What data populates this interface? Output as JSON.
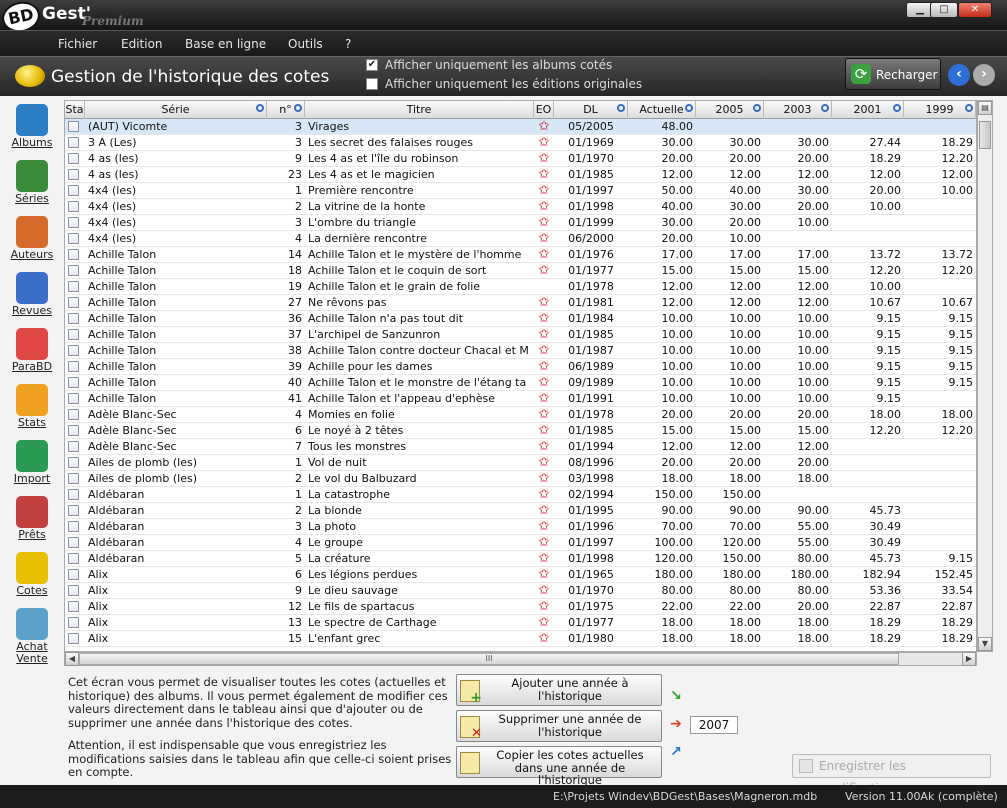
{
  "app": {
    "logo_bd": "BD",
    "logo_gest": "Gest'",
    "logo_premium": "Premium"
  },
  "menu": [
    "Fichier",
    "Edition",
    "Base en ligne",
    "Outils",
    "?"
  ],
  "header": {
    "title": "Gestion de l'historique des cotes",
    "chk1": "Afficher uniquement les albums cotés",
    "chk2": "Afficher uniquement les éditions originales",
    "reload": "Recharger"
  },
  "sidebar": [
    {
      "label": "Albums",
      "color": "#2d7fc4"
    },
    {
      "label": "Séries",
      "color": "#3c8a3c"
    },
    {
      "label": "Auteurs",
      "color": "#d66a2a"
    },
    {
      "label": "Revues",
      "color": "#3a6fc8"
    },
    {
      "label": "ParaBD",
      "color": "#e04848"
    },
    {
      "label": "Stats",
      "color": "#f0a020"
    },
    {
      "label": "Import",
      "color": "#2a9a55"
    },
    {
      "label": "Prêts",
      "color": "#c04040"
    },
    {
      "label": "Cotes",
      "color": "#e8c000"
    },
    {
      "label": "Achat Vente",
      "color": "#5aa0c8"
    }
  ],
  "columns": [
    "Sta",
    "Série",
    "n°",
    "Titre",
    "EO",
    "DL",
    "Actuelle",
    "2005",
    "2003",
    "2001",
    "1999"
  ],
  "rows": [
    [
      "(AUT) Vicomte",
      "3",
      "Virages",
      1,
      "05/2005",
      "48.00",
      "",
      "",
      "",
      ""
    ],
    [
      "3 A (Les)",
      "3",
      "Les secret des falaises rouges",
      1,
      "01/1969",
      "30.00",
      "30.00",
      "30.00",
      "27.44",
      "18.29"
    ],
    [
      "4 as (les)",
      "9",
      "Les 4 as et l'île du robinson",
      1,
      "01/1970",
      "20.00",
      "20.00",
      "20.00",
      "18.29",
      "12.20"
    ],
    [
      "4 as (les)",
      "23",
      "Les 4 as et le magicien",
      1,
      "01/1985",
      "12.00",
      "12.00",
      "12.00",
      "12.00",
      "12.00"
    ],
    [
      "4x4 (les)",
      "1",
      "Première rencontre",
      1,
      "01/1997",
      "50.00",
      "40.00",
      "30.00",
      "20.00",
      "10.00"
    ],
    [
      "4x4 (les)",
      "2",
      "La vitrine de la honte",
      1,
      "01/1998",
      "40.00",
      "30.00",
      "20.00",
      "10.00",
      ""
    ],
    [
      "4x4 (les)",
      "3",
      "L'ombre du triangle",
      1,
      "01/1999",
      "30.00",
      "20.00",
      "10.00",
      "",
      ""
    ],
    [
      "4x4 (les)",
      "4",
      "La dernière rencontre",
      1,
      "06/2000",
      "20.00",
      "10.00",
      "",
      "",
      ""
    ],
    [
      "Achille Talon",
      "14",
      "Achille Talon et le mystère de l'homme",
      1,
      "01/1976",
      "17.00",
      "17.00",
      "17.00",
      "13.72",
      "13.72"
    ],
    [
      "Achille Talon",
      "18",
      "Achille Talon et le coquin de sort",
      1,
      "01/1977",
      "15.00",
      "15.00",
      "15.00",
      "12.20",
      "12.20"
    ],
    [
      "Achille Talon",
      "19",
      "Achille Talon et le grain de folie",
      0,
      "01/1978",
      "12.00",
      "12.00",
      "12.00",
      "10.00",
      ""
    ],
    [
      "Achille Talon",
      "27",
      "Ne rêvons pas",
      1,
      "01/1981",
      "12.00",
      "12.00",
      "12.00",
      "10.67",
      "10.67"
    ],
    [
      "Achille Talon",
      "36",
      "Achille Talon n'a pas tout dit",
      1,
      "01/1984",
      "10.00",
      "10.00",
      "10.00",
      "9.15",
      "9.15"
    ],
    [
      "Achille Talon",
      "37",
      "L'archipel de Sanzunron",
      1,
      "01/1985",
      "10.00",
      "10.00",
      "10.00",
      "9.15",
      "9.15"
    ],
    [
      "Achille Talon",
      "38",
      "Achille Talon contre docteur Chacal et M",
      1,
      "01/1987",
      "10.00",
      "10.00",
      "10.00",
      "9.15",
      "9.15"
    ],
    [
      "Achille Talon",
      "39",
      "Achille pour les dames",
      1,
      "06/1989",
      "10.00",
      "10.00",
      "10.00",
      "9.15",
      "9.15"
    ],
    [
      "Achille Talon",
      "40",
      "Achille Talon et le monstre de l'étang ta",
      1,
      "09/1989",
      "10.00",
      "10.00",
      "10.00",
      "9.15",
      "9.15"
    ],
    [
      "Achille Talon",
      "41",
      "Achille Talon et l'appeau d'ephèse",
      1,
      "01/1991",
      "10.00",
      "10.00",
      "10.00",
      "9.15",
      ""
    ],
    [
      "Adèle Blanc-Sec",
      "4",
      "Momies en folie",
      1,
      "01/1978",
      "20.00",
      "20.00",
      "20.00",
      "18.00",
      "18.00"
    ],
    [
      "Adèle Blanc-Sec",
      "6",
      "Le noyé à 2 têtes",
      1,
      "01/1985",
      "15.00",
      "15.00",
      "15.00",
      "12.20",
      "12.20"
    ],
    [
      "Adèle Blanc-Sec",
      "7",
      "Tous les monstres",
      1,
      "01/1994",
      "12.00",
      "12.00",
      "12.00",
      "",
      ""
    ],
    [
      "Ailes de plomb (les)",
      "1",
      "Vol de nuit",
      1,
      "08/1996",
      "20.00",
      "20.00",
      "20.00",
      "",
      ""
    ],
    [
      "Ailes de plomb (les)",
      "2",
      "Le vol du Balbuzard",
      1,
      "03/1998",
      "18.00",
      "18.00",
      "18.00",
      "",
      ""
    ],
    [
      "Aldébaran",
      "1",
      "La catastrophe",
      1,
      "02/1994",
      "150.00",
      "150.00",
      "",
      "",
      ""
    ],
    [
      "Aldébaran",
      "2",
      "La blonde",
      1,
      "01/1995",
      "90.00",
      "90.00",
      "90.00",
      "45.73",
      ""
    ],
    [
      "Aldébaran",
      "3",
      "La photo",
      1,
      "01/1996",
      "70.00",
      "70.00",
      "55.00",
      "30.49",
      ""
    ],
    [
      "Aldébaran",
      "4",
      "Le groupe",
      1,
      "01/1997",
      "100.00",
      "120.00",
      "55.00",
      "30.49",
      ""
    ],
    [
      "Aldébaran",
      "5",
      "La créature",
      1,
      "01/1998",
      "120.00",
      "150.00",
      "80.00",
      "45.73",
      "9.15"
    ],
    [
      "Alix",
      "6",
      "Les légions perdues",
      1,
      "01/1965",
      "180.00",
      "180.00",
      "180.00",
      "182.94",
      "152.45"
    ],
    [
      "Alix",
      "9",
      "Le dieu sauvage",
      1,
      "01/1970",
      "80.00",
      "80.00",
      "80.00",
      "53.36",
      "33.54"
    ],
    [
      "Alix",
      "12",
      "Le fils de spartacus",
      1,
      "01/1975",
      "22.00",
      "22.00",
      "20.00",
      "22.87",
      "22.87"
    ],
    [
      "Alix",
      "13",
      "Le spectre de Carthage",
      1,
      "01/1977",
      "18.00",
      "18.00",
      "18.00",
      "18.29",
      "18.29"
    ],
    [
      "Alix",
      "15",
      "L'enfant grec",
      1,
      "01/1980",
      "18.00",
      "18.00",
      "18.00",
      "18.29",
      "18.29"
    ]
  ],
  "footer": {
    "desc1": "Cet écran vous permet de visualiser toutes les cotes (actuelles et historique) des albums. Il vous permet également de modifier ces valeurs directement dans le tableau ainsi que d'ajouter ou de supprimer une année dans l'historique des cotes.",
    "desc2": "Attention, il est indispensable que vous enregistriez les modifications saisies dans le tableau afin que celle-ci soient prises en compte.",
    "add": "Ajouter une année à l'historique",
    "del": "Supprimer une année de l'historique",
    "copy": "Copier les cotes actuelles dans une année de l'historique",
    "year": "2007",
    "save": "Enregistrer les modifications"
  },
  "status": {
    "path": "E:\\Projets Windev\\BDGest\\Bases\\Magneron.mdb",
    "version": "Version 11.00Ak (complète)"
  },
  "scroll": {
    "hthumb": "III"
  }
}
